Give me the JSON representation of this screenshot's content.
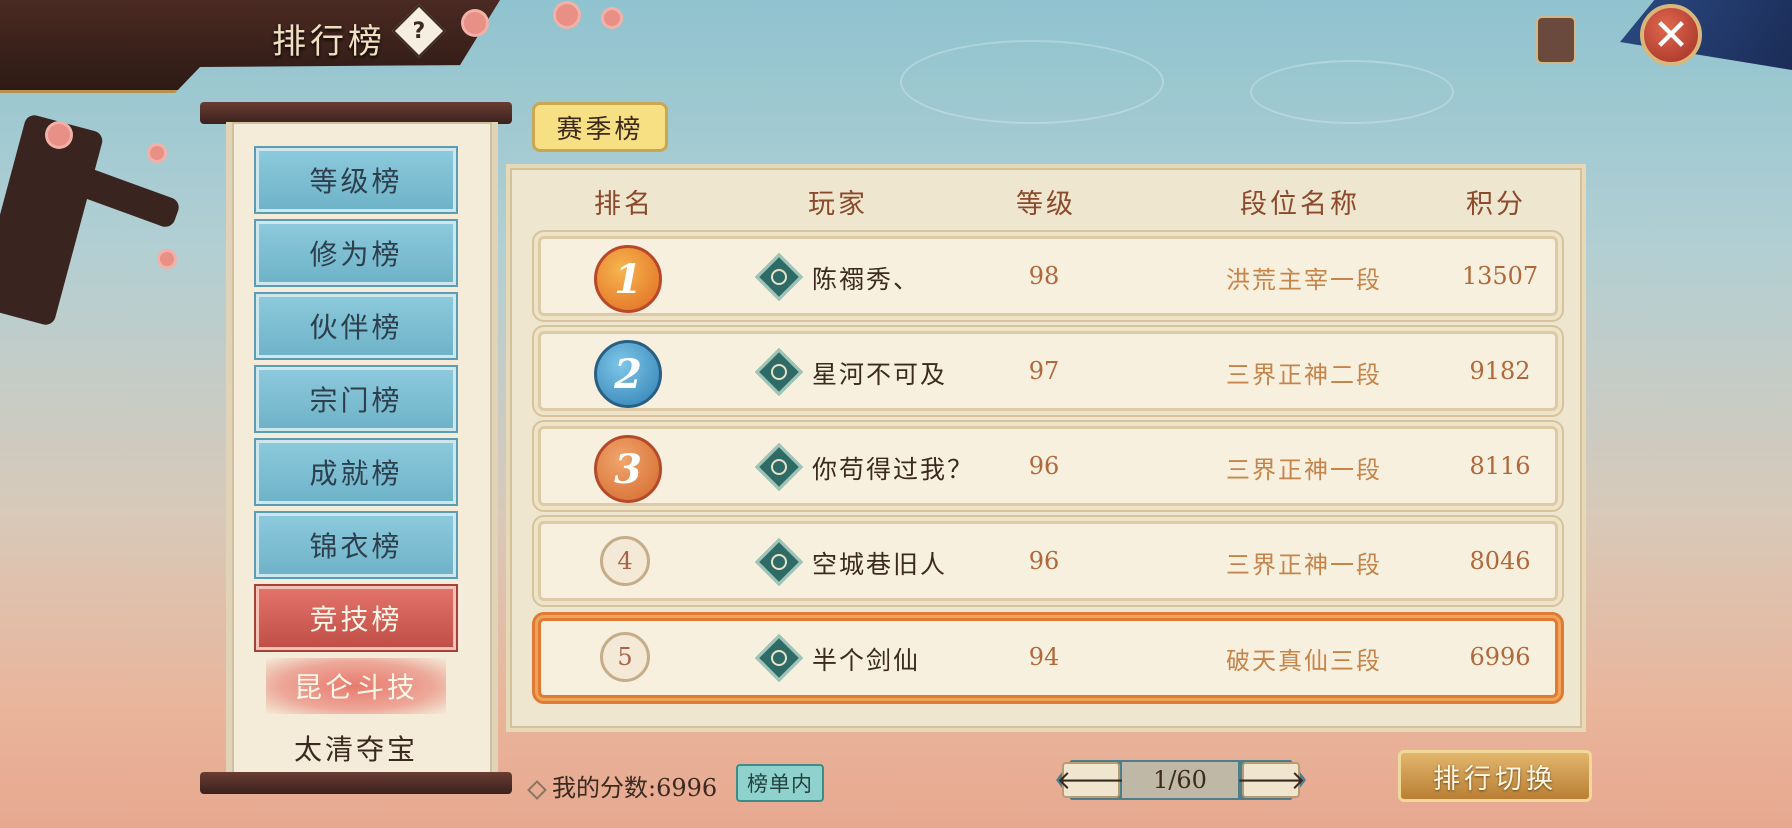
{
  "header": {
    "title": "排行榜",
    "help_icon": "?",
    "close_icon": "✕"
  },
  "sidebar": {
    "tabs": [
      {
        "label": "等级榜",
        "active": false
      },
      {
        "label": "修为榜",
        "active": false
      },
      {
        "label": "伙伴榜",
        "active": false
      },
      {
        "label": "宗门榜",
        "active": false
      },
      {
        "label": "成就榜",
        "active": false
      },
      {
        "label": "锦衣榜",
        "active": false
      },
      {
        "label": "竞技榜",
        "active": true
      }
    ],
    "subtabs": [
      {
        "label": "昆仑斗技",
        "active": true
      },
      {
        "label": "太清夺宝",
        "active": false
      }
    ]
  },
  "season_tag": "赛季榜",
  "table": {
    "columns": [
      "排名",
      "玩家",
      "等级",
      "段位名称",
      "积分"
    ],
    "rows": [
      {
        "rank": "1",
        "player": "陈禤秀、",
        "level": "98",
        "tier": "洪荒主宰一段",
        "score": "13507"
      },
      {
        "rank": "2",
        "player": "星河不可及",
        "level": "97",
        "tier": "三界正神二段",
        "score": "9182"
      },
      {
        "rank": "3",
        "player": "你苟得过我？",
        "level": "96",
        "tier": "三界正神一段",
        "score": "8116"
      },
      {
        "rank": "4",
        "player": "空城巷旧人",
        "level": "96",
        "tier": "三界正神一段",
        "score": "8046"
      },
      {
        "rank": "5",
        "player": "半个剑仙",
        "level": "94",
        "tier": "破天真仙三段",
        "score": "6996"
      }
    ]
  },
  "footer": {
    "my_score": "我的分数:6996",
    "in_list_badge": "榜单内",
    "page": "1/60",
    "prev_icon": "🡐",
    "next_icon": "🡒",
    "switch_button": "排行切换"
  }
}
